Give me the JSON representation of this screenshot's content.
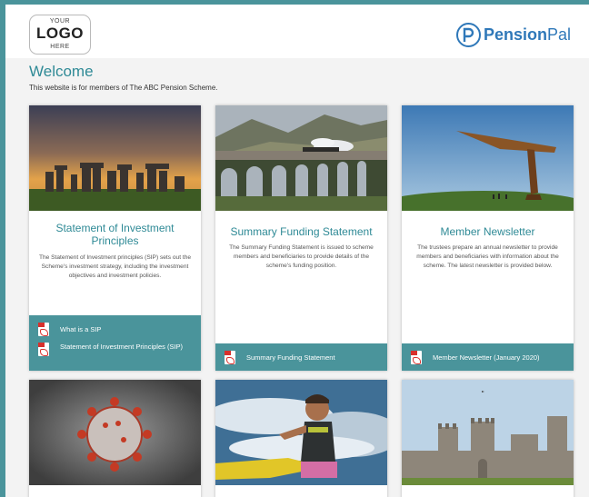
{
  "header": {
    "logo": {
      "top": "YOUR",
      "middle": "LOGO",
      "bottom": "HERE"
    },
    "brand": {
      "part1": "Pension",
      "part2": "Pal",
      "color": "#2f78b9"
    }
  },
  "welcome": {
    "title": "Welcome",
    "intro": "This website is for members of The ABC Pension Scheme."
  },
  "cards": [
    {
      "title": "Statement of Investment Principles",
      "description": "The Statement of Investment principles (SIP) sets out the Scheme's investment strategy, including the investment objectives and investment policies.",
      "image": "stonehenge-sunset",
      "links": [
        "What is a SIP",
        "Statement of Investment Principles (SIP)"
      ]
    },
    {
      "title": "Summary Funding Statement",
      "description": "The Summary Funding Statement is issued to scheme members and beneficiaries to provide details of the scheme's funding position.",
      "image": "viaduct-steam-train",
      "links": [
        "Summary Funding Statement"
      ]
    },
    {
      "title": "Member Newsletter",
      "description": "The trustees prepare an annual newsletter to provide members and beneficiaries with information about the scheme. The latest newsletter is provided below.",
      "image": "angel-of-the-north",
      "links": [
        "Member Newsletter (January 2020)"
      ]
    },
    {
      "image": "coronavirus"
    },
    {
      "image": "jet-ski-rider"
    },
    {
      "image": "castle"
    }
  ],
  "colors": {
    "accent": "#4a949b",
    "title": "#2f8a96"
  }
}
